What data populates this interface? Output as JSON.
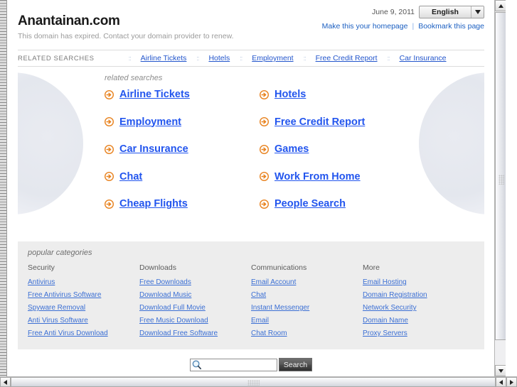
{
  "header": {
    "site_title": "Anantainan.com",
    "subtitle": "This domain has expired. Contact your domain provider to renew.",
    "date": "June 9, 2011",
    "language_selected": "English",
    "language_arrow_icon": "chevron-down-icon",
    "make_homepage_link": "Make this your homepage",
    "divider": "|",
    "bookmark_link": "Bookmark this page"
  },
  "related_bar": {
    "label": "RELATED SEARCHES",
    "separator": "::",
    "links": [
      "Airline Tickets",
      "Hotels",
      "Employment",
      "Free Credit Report",
      "Car Insurance"
    ]
  },
  "related_searches": {
    "title": "related searches",
    "arrow_icon": "arrow-circle-right-icon",
    "items": [
      "Airline Tickets",
      "Hotels",
      "Employment",
      "Free Credit Report",
      "Car Insurance",
      "Games",
      "Chat",
      "Work From Home",
      "Cheap Flights",
      "People Search"
    ]
  },
  "popular_categories": {
    "title": "popular categories",
    "columns": [
      {
        "heading": "Security",
        "links": [
          "Antivirus",
          "Free Antivirus Software",
          "Spyware Removal",
          "Anti Virus Software",
          "Free Anti Virus Download"
        ]
      },
      {
        "heading": "Downloads",
        "links": [
          "Free Downloads",
          "Download Music",
          "Download Full Movie",
          "Free Music Download",
          "Download Free Software"
        ]
      },
      {
        "heading": "Communications",
        "links": [
          "Email Account",
          "Chat",
          "Instant Messenger",
          "Email",
          "Chat Room"
        ]
      },
      {
        "heading": "More",
        "links": [
          "Email Hosting",
          "Domain Registration",
          "Network Security",
          "Domain Name",
          "Proxy Servers"
        ]
      }
    ]
  },
  "search": {
    "icon": "magnifier-icon",
    "value": "",
    "placeholder": "",
    "button_label": "Search"
  },
  "scrollbars": {
    "up_arrow": "▲",
    "down_arrow": "▼",
    "left_arrow": "◀",
    "right_arrow": "▶"
  },
  "colors": {
    "link_blue": "#2255ee",
    "nav_blue": "#2255cc",
    "cat_link_blue": "#3b6fd4",
    "arrow_orange": "#e8821e",
    "panel_grey": "#ededed"
  }
}
